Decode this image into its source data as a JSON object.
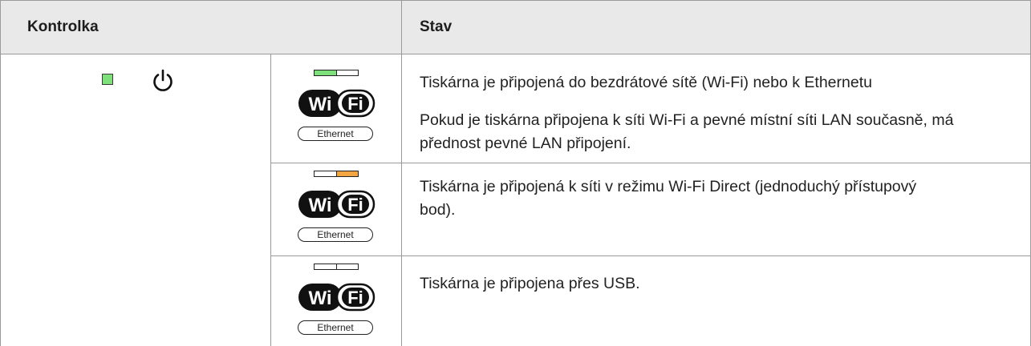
{
  "table": {
    "header": {
      "col1": "Kontrolka",
      "col2": "Stav"
    },
    "power_led": {
      "icon": "power-icon",
      "led_color": "#7ee07b"
    },
    "rows": [
      {
        "indicator": {
          "left_segment": "green",
          "right_segment": "off",
          "wifi_label_1": "Wi",
          "wifi_label_2": "Fi",
          "ethernet_label": "Ethernet"
        },
        "status": [
          "Tiskárna je připojená do bezdrátové sítě (Wi-Fi) nebo k Ethernetu",
          "Pokud je tiskárna připojena k síti Wi-Fi a pevné místní síti LAN současně, má",
          "přednost pevné LAN připojení."
        ]
      },
      {
        "indicator": {
          "left_segment": "off",
          "right_segment": "orange",
          "wifi_label_1": "Wi",
          "wifi_label_2": "Fi",
          "ethernet_label": "Ethernet"
        },
        "status": [
          "Tiskárna je připojená k síti v režimu Wi-Fi Direct (jednoduchý přístupový",
          "bod)."
        ]
      },
      {
        "indicator": {
          "left_segment": "off",
          "right_segment": "off",
          "wifi_label_1": "Wi",
          "wifi_label_2": "Fi",
          "ethernet_label": "Ethernet"
        },
        "status": [
          "Tiskárna je připojena přes USB."
        ]
      }
    ],
    "colors": {
      "led_green": "#7ee07b",
      "led_orange": "#f3a542",
      "header_bg": "#e9e9e9",
      "border": "#9a9a9a"
    }
  }
}
